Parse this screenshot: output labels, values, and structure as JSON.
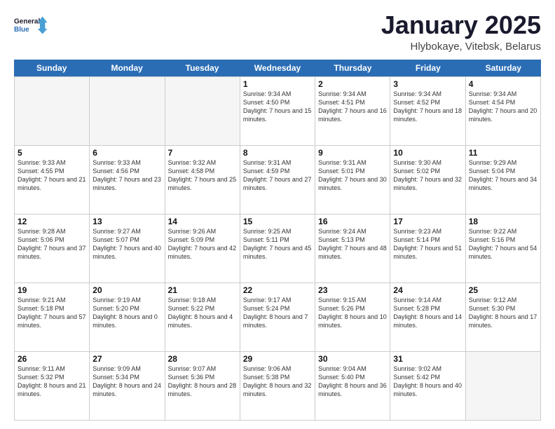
{
  "logo": {
    "line1": "General",
    "line2": "Blue"
  },
  "title": "January 2025",
  "location": "Hlybokaye, Vitebsk, Belarus",
  "days_of_week": [
    "Sunday",
    "Monday",
    "Tuesday",
    "Wednesday",
    "Thursday",
    "Friday",
    "Saturday"
  ],
  "weeks": [
    [
      {
        "day": "",
        "info": ""
      },
      {
        "day": "",
        "info": ""
      },
      {
        "day": "",
        "info": ""
      },
      {
        "day": "1",
        "info": "Sunrise: 9:34 AM\nSunset: 4:50 PM\nDaylight: 7 hours\nand 15 minutes."
      },
      {
        "day": "2",
        "info": "Sunrise: 9:34 AM\nSunset: 4:51 PM\nDaylight: 7 hours\nand 16 minutes."
      },
      {
        "day": "3",
        "info": "Sunrise: 9:34 AM\nSunset: 4:52 PM\nDaylight: 7 hours\nand 18 minutes."
      },
      {
        "day": "4",
        "info": "Sunrise: 9:34 AM\nSunset: 4:54 PM\nDaylight: 7 hours\nand 20 minutes."
      }
    ],
    [
      {
        "day": "5",
        "info": "Sunrise: 9:33 AM\nSunset: 4:55 PM\nDaylight: 7 hours\nand 21 minutes."
      },
      {
        "day": "6",
        "info": "Sunrise: 9:33 AM\nSunset: 4:56 PM\nDaylight: 7 hours\nand 23 minutes."
      },
      {
        "day": "7",
        "info": "Sunrise: 9:32 AM\nSunset: 4:58 PM\nDaylight: 7 hours\nand 25 minutes."
      },
      {
        "day": "8",
        "info": "Sunrise: 9:31 AM\nSunset: 4:59 PM\nDaylight: 7 hours\nand 27 minutes."
      },
      {
        "day": "9",
        "info": "Sunrise: 9:31 AM\nSunset: 5:01 PM\nDaylight: 7 hours\nand 30 minutes."
      },
      {
        "day": "10",
        "info": "Sunrise: 9:30 AM\nSunset: 5:02 PM\nDaylight: 7 hours\nand 32 minutes."
      },
      {
        "day": "11",
        "info": "Sunrise: 9:29 AM\nSunset: 5:04 PM\nDaylight: 7 hours\nand 34 minutes."
      }
    ],
    [
      {
        "day": "12",
        "info": "Sunrise: 9:28 AM\nSunset: 5:06 PM\nDaylight: 7 hours\nand 37 minutes."
      },
      {
        "day": "13",
        "info": "Sunrise: 9:27 AM\nSunset: 5:07 PM\nDaylight: 7 hours\nand 40 minutes."
      },
      {
        "day": "14",
        "info": "Sunrise: 9:26 AM\nSunset: 5:09 PM\nDaylight: 7 hours\nand 42 minutes."
      },
      {
        "day": "15",
        "info": "Sunrise: 9:25 AM\nSunset: 5:11 PM\nDaylight: 7 hours\nand 45 minutes."
      },
      {
        "day": "16",
        "info": "Sunrise: 9:24 AM\nSunset: 5:13 PM\nDaylight: 7 hours\nand 48 minutes."
      },
      {
        "day": "17",
        "info": "Sunrise: 9:23 AM\nSunset: 5:14 PM\nDaylight: 7 hours\nand 51 minutes."
      },
      {
        "day": "18",
        "info": "Sunrise: 9:22 AM\nSunset: 5:16 PM\nDaylight: 7 hours\nand 54 minutes."
      }
    ],
    [
      {
        "day": "19",
        "info": "Sunrise: 9:21 AM\nSunset: 5:18 PM\nDaylight: 7 hours\nand 57 minutes."
      },
      {
        "day": "20",
        "info": "Sunrise: 9:19 AM\nSunset: 5:20 PM\nDaylight: 8 hours\nand 0 minutes."
      },
      {
        "day": "21",
        "info": "Sunrise: 9:18 AM\nSunset: 5:22 PM\nDaylight: 8 hours\nand 4 minutes."
      },
      {
        "day": "22",
        "info": "Sunrise: 9:17 AM\nSunset: 5:24 PM\nDaylight: 8 hours\nand 7 minutes."
      },
      {
        "day": "23",
        "info": "Sunrise: 9:15 AM\nSunset: 5:26 PM\nDaylight: 8 hours\nand 10 minutes."
      },
      {
        "day": "24",
        "info": "Sunrise: 9:14 AM\nSunset: 5:28 PM\nDaylight: 8 hours\nand 14 minutes."
      },
      {
        "day": "25",
        "info": "Sunrise: 9:12 AM\nSunset: 5:30 PM\nDaylight: 8 hours\nand 17 minutes."
      }
    ],
    [
      {
        "day": "26",
        "info": "Sunrise: 9:11 AM\nSunset: 5:32 PM\nDaylight: 8 hours\nand 21 minutes."
      },
      {
        "day": "27",
        "info": "Sunrise: 9:09 AM\nSunset: 5:34 PM\nDaylight: 8 hours\nand 24 minutes."
      },
      {
        "day": "28",
        "info": "Sunrise: 9:07 AM\nSunset: 5:36 PM\nDaylight: 8 hours\nand 28 minutes."
      },
      {
        "day": "29",
        "info": "Sunrise: 9:06 AM\nSunset: 5:38 PM\nDaylight: 8 hours\nand 32 minutes."
      },
      {
        "day": "30",
        "info": "Sunrise: 9:04 AM\nSunset: 5:40 PM\nDaylight: 8 hours\nand 36 minutes."
      },
      {
        "day": "31",
        "info": "Sunrise: 9:02 AM\nSunset: 5:42 PM\nDaylight: 8 hours\nand 40 minutes."
      },
      {
        "day": "",
        "info": ""
      }
    ]
  ]
}
